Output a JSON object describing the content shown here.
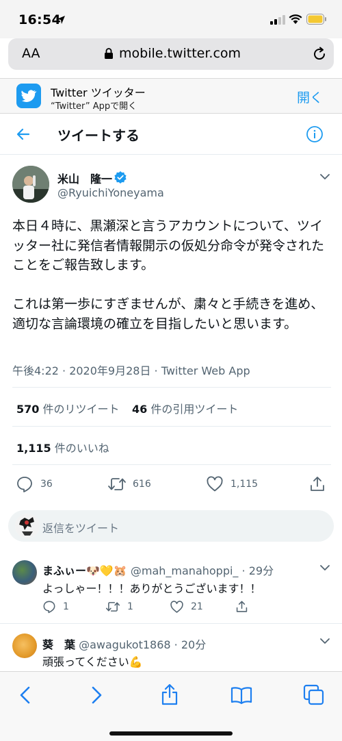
{
  "status_bar": {
    "time": "16:54"
  },
  "browser": {
    "text_size_label": "AA",
    "url": "mobile.twitter.com"
  },
  "app_banner": {
    "title": "Twitter ツイッター",
    "subtitle": "“Twitter” Appで開く",
    "open_label": "開く"
  },
  "header": {
    "title": "ツイートする"
  },
  "tweet": {
    "author_name": "米山　隆一",
    "author_handle": "@RyuichiYoneyama",
    "text": "本日４時に、黒瀬深と言うアカウントについて、ツイッター社に発信者情報開示の仮処分命令が発令されたことをご報告致します。\n\nこれは第一歩にすぎませんが、粛々と手続きを進め、適切な言論環境の確立を目指したいと思います。",
    "meta": "午後4:22 · 2020年9月28日 · Twitter Web App",
    "retweets_count": "570",
    "retweets_label": "件のリツイート",
    "quotes_count": "46",
    "quotes_label": "件の引用ツイート",
    "likes_count": "1,115",
    "likes_label": "件のいいね",
    "actions": {
      "replies": "36",
      "retweets": "616",
      "likes": "1,115"
    }
  },
  "reply_composer": {
    "placeholder": "返信をツイート"
  },
  "replies": [
    {
      "name": "まふぃー🐶💛🐹",
      "handle": "@mah_manahoppi_",
      "time": "· 29分",
      "text": "よっしゃー！！！ありがとうございます！！",
      "counts": {
        "replies": "1",
        "retweets": "1",
        "likes": "21"
      }
    },
    {
      "name": "葵　葉",
      "handle": "@awagukot1868",
      "time": "· 20分",
      "text": "頑張ってください💪"
    }
  ],
  "colors": {
    "accent": "#1d9bf0",
    "verified": "#1d9bf0",
    "text": "#0f1419",
    "muted": "#536471"
  }
}
